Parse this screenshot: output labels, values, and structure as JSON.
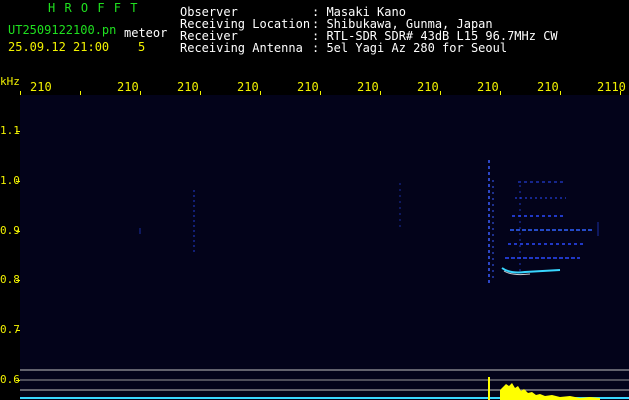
{
  "title": "H R O F F T",
  "file_name": "UT2509122100.pn",
  "type_label": "meteor",
  "timestamp": "25.09.12 21:00",
  "count": "5",
  "info_labels": [
    "Observer",
    "Receiving Location",
    "Receiver",
    "Receiving Antenna"
  ],
  "info_values": [
    ": Masaki Kano",
    ": Shibukawa, Gunma, Japan",
    ": RTL-SDR SDR# 43dB L15 96.7MHz CW",
    ": 5el Yagi Az 280 for Seoul"
  ],
  "y_unit": "kHz",
  "y_ticks": [
    "1.1",
    "1.0",
    "0.9",
    "0.8",
    "0.7",
    "0.6"
  ],
  "x_ticks": [
    "210",
    "210",
    "210",
    "210",
    "210",
    "210",
    "210",
    "210",
    "210",
    "2110"
  ],
  "colors": {
    "header_green": "#1fe01f",
    "label_yellow": "#f2f200",
    "text_white": "#ffffff",
    "plot_bg": "#03031a",
    "signal_blue": "#2a4aff",
    "signal_cyan": "#38d6ff",
    "amplitude_yellow": "#ffff00"
  }
}
